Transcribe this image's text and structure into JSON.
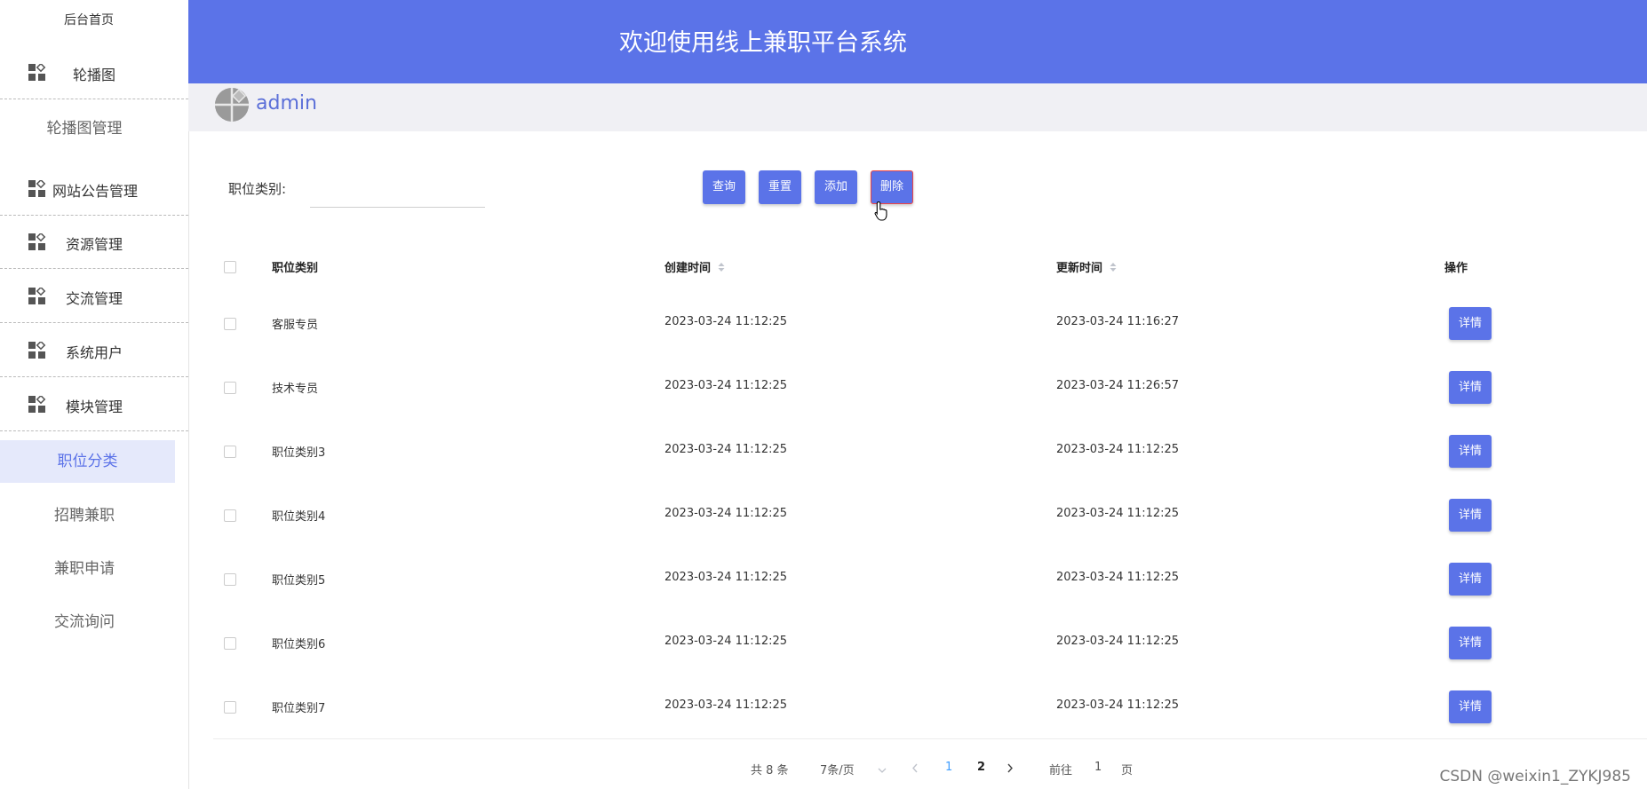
{
  "sidebar": {
    "home": "后台首页",
    "groups": [
      {
        "label": "轮播图",
        "sub": [
          "轮播图管理"
        ]
      },
      {
        "label": "网站公告管理"
      },
      {
        "label": "资源管理"
      },
      {
        "label": "交流管理"
      },
      {
        "label": "系统用户"
      },
      {
        "label": "模块管理",
        "sub": [
          "职位分类",
          "招聘兼职",
          "兼职申请",
          "交流询问"
        ]
      }
    ],
    "active": "职位分类"
  },
  "header": {
    "title": "欢迎使用线上兼职平台系统"
  },
  "user": {
    "name": "admin"
  },
  "filter": {
    "label": "职位类别:",
    "value": "",
    "placeholder": ""
  },
  "toolbar": {
    "query": "查询",
    "reset": "重置",
    "add": "添加",
    "delete": "删除"
  },
  "table": {
    "headers": {
      "category": "职位类别",
      "created": "创建时间",
      "updated": "更新时间",
      "actions": "操作"
    },
    "action_label": "详情",
    "rows": [
      {
        "category": "客服专员",
        "created": "2023-03-24 11:12:25",
        "updated": "2023-03-24 11:16:27"
      },
      {
        "category": "技术专员",
        "created": "2023-03-24 11:12:25",
        "updated": "2023-03-24 11:26:57"
      },
      {
        "category": "职位类别3",
        "created": "2023-03-24 11:12:25",
        "updated": "2023-03-24 11:12:25"
      },
      {
        "category": "职位类别4",
        "created": "2023-03-24 11:12:25",
        "updated": "2023-03-24 11:12:25"
      },
      {
        "category": "职位类别5",
        "created": "2023-03-24 11:12:25",
        "updated": "2023-03-24 11:12:25"
      },
      {
        "category": "职位类别6",
        "created": "2023-03-24 11:12:25",
        "updated": "2023-03-24 11:12:25"
      },
      {
        "category": "职位类别7",
        "created": "2023-03-24 11:12:25",
        "updated": "2023-03-24 11:12:25"
      }
    ]
  },
  "pagination": {
    "total": "共 8 条",
    "page_size": "7条/页",
    "pages": [
      "1",
      "2"
    ],
    "current": "1",
    "goto_prefix": "前往",
    "goto_value": "1",
    "goto_suffix": "页"
  },
  "watermark": "CSDN @weixin1_ZYKJ985",
  "colors": {
    "primary": "#5b73e8",
    "active_bg": "#e5e9fb",
    "page_current": "#409eff"
  }
}
